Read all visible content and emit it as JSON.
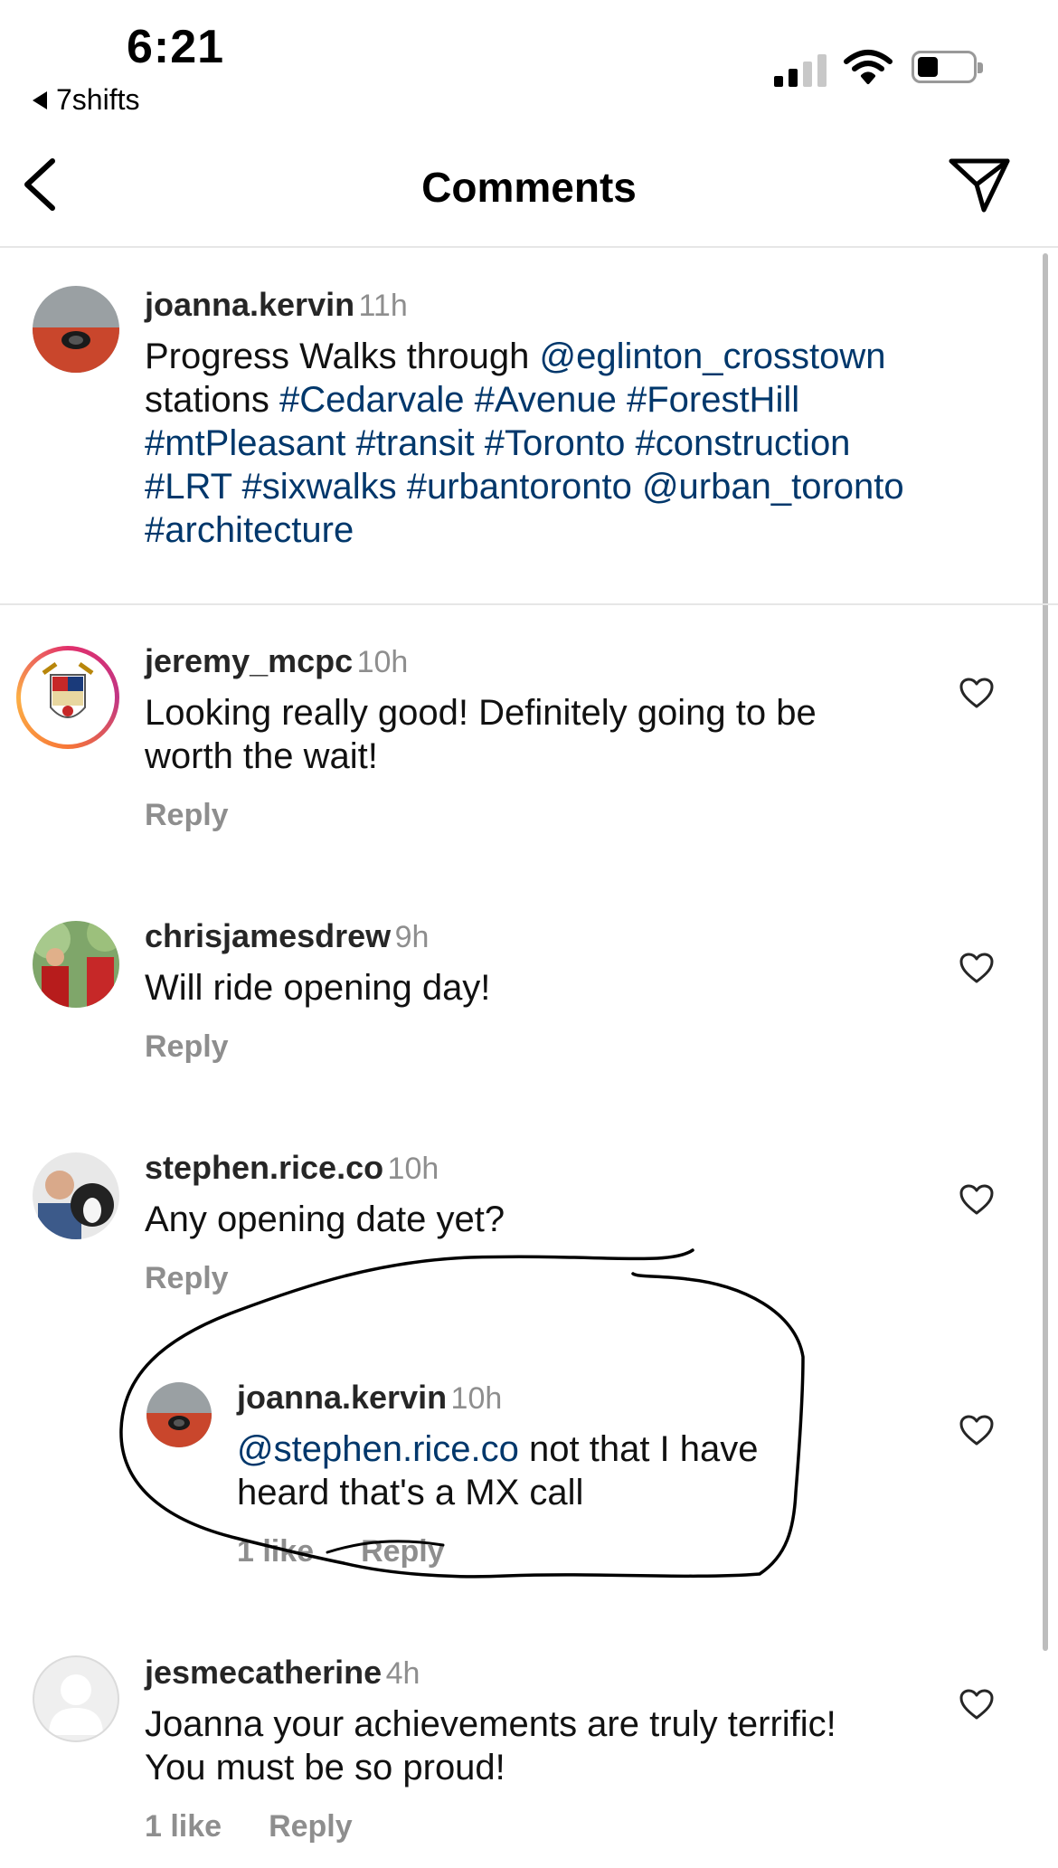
{
  "status_bar": {
    "time": "6:21",
    "back_app": "7shifts"
  },
  "header": {
    "title": "Comments"
  },
  "caption": {
    "username": "joanna.kervin",
    "time": "11h",
    "line1_text": "Progress Walks through ",
    "line1_link": "@eglinton_crosstown",
    "line2_text": "stations ",
    "line2_tags": "#Cedarvale #Avenue #ForestHill",
    "line3": "#mtPleasant #transit #Toronto #construction",
    "line4": "#LRT #sixwalks #urbantoronto @urban_toronto",
    "line5": "#architecture"
  },
  "comments": [
    {
      "username": "jeremy_mcpc",
      "time": "10h",
      "line1": "Looking really good! Definitely going to be",
      "line2": "worth the wait!",
      "reply": "Reply"
    },
    {
      "username": "chrisjamesdrew",
      "time": "9h",
      "line1": "Will ride opening day!",
      "reply": "Reply"
    },
    {
      "username": "stephen.rice.co",
      "time": "10h",
      "line1": "Any opening date yet?",
      "reply": "Reply"
    },
    {
      "username": "joanna.kervin",
      "time": "10h",
      "mention": "@stephen.rice.co",
      "line1_rest": " not that I have",
      "line2": "heard that's a MX call",
      "likes": "1 like",
      "reply": "Reply"
    },
    {
      "username": "jesmecatherine",
      "time": "4h",
      "line1": "Joanna your achievements are truly terrific!",
      "line2": "You must be so proud!",
      "likes": "1 like",
      "reply": "Reply"
    }
  ],
  "colors": {
    "link": "#00376b",
    "muted": "#8e8e8e",
    "annotation": "#000000"
  }
}
